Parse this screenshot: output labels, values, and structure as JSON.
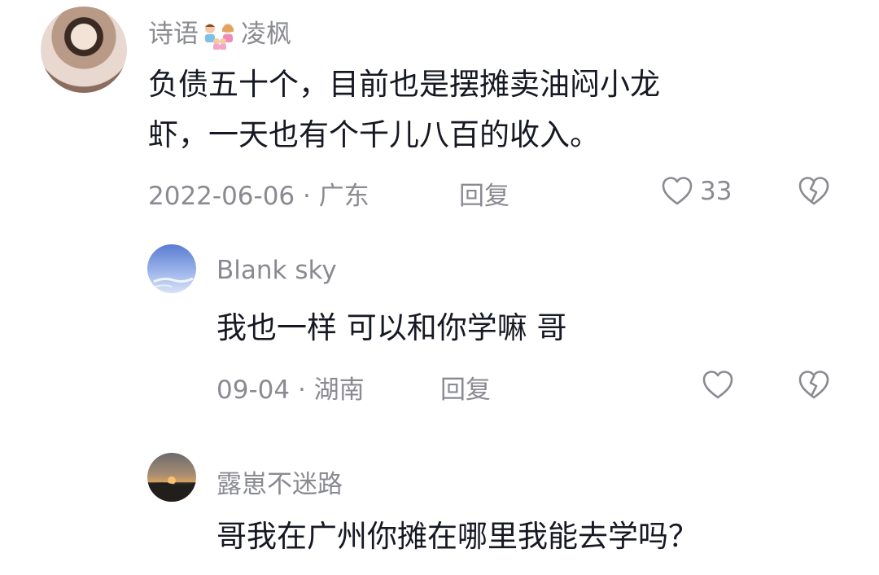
{
  "comments": [
    {
      "username": "诗语",
      "username_suffix": "凌枫",
      "username_emoji": "family-emoji",
      "text_line1": "负债五十个，目前也是摆摊卖油闷小龙",
      "text_line2": "虾，一天也有个千儿八百的收入。",
      "date": "2022-06-06",
      "location": "· 广东",
      "reply_label": "回复",
      "like_count": "33",
      "like_icon": "heart-outline-icon",
      "dislike_icon": "broken-heart-icon"
    },
    {
      "username": "Blank sky",
      "text": "我也一样  可以和你学嘛  哥",
      "date": "09-04",
      "location": "· 湖南",
      "reply_label": "回复",
      "like_icon": "heart-outline-icon",
      "dislike_icon": "broken-heart-icon"
    },
    {
      "username": "露崽不迷路",
      "text": "哥我在广州你摊在哪里我能去学吗？"
    }
  ],
  "colors": {
    "text_primary": "#161823",
    "text_secondary": "#8a8b91",
    "background": "#ffffff"
  }
}
